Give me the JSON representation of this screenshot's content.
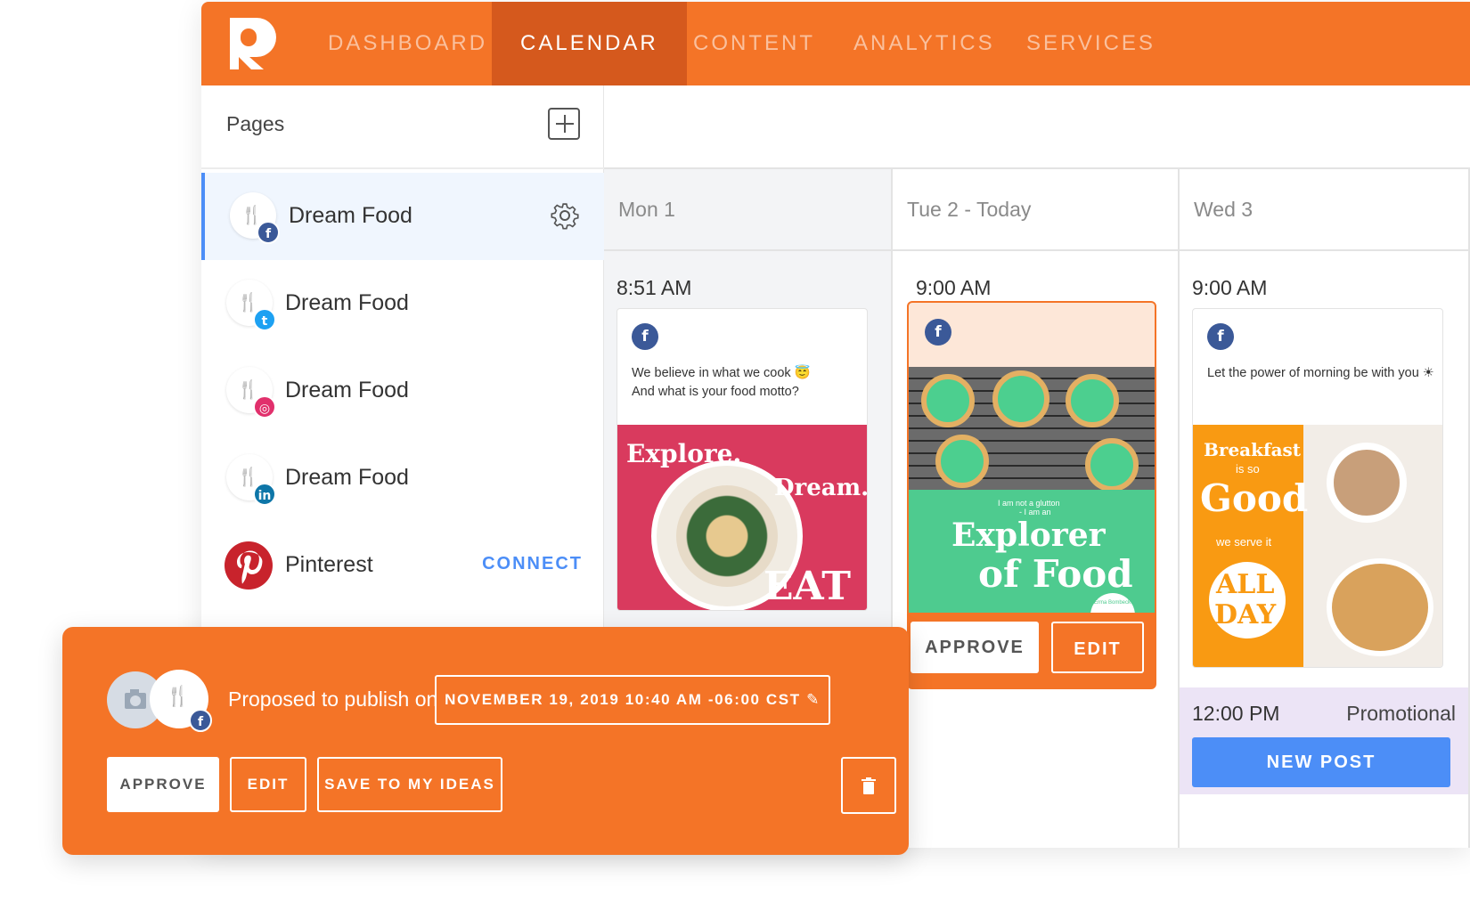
{
  "nav": {
    "items": [
      "DASHBOARD",
      "CALENDAR",
      "CONTENT",
      "ANALYTICS",
      "SERVICES"
    ],
    "active": "CALENDAR"
  },
  "sidebar": {
    "title": "Pages",
    "pages": [
      {
        "name": "Dream Food",
        "network": "facebook"
      },
      {
        "name": "Dream Food",
        "network": "twitter"
      },
      {
        "name": "Dream Food",
        "network": "instagram"
      },
      {
        "name": "Dream Food",
        "network": "linkedin"
      },
      {
        "name": "Pinterest",
        "network": "pinterest",
        "action": "CONNECT"
      }
    ]
  },
  "calendar": {
    "days": [
      {
        "title": "Mon 1",
        "time": "8:51 AM",
        "post_text": [
          "We believe in what we cook 😇",
          "And what is your food motto?"
        ],
        "image_text": [
          "Explore.",
          "Dream.",
          "EAT"
        ]
      },
      {
        "title": "Tue 2 - Today",
        "time": "9:00 AM",
        "image_text": [
          "I am not a glutton",
          "- I am an",
          "Explorer",
          "of Food",
          "Erma Bombeck"
        ],
        "approve": "APPROVE",
        "edit": "EDIT"
      },
      {
        "title": "Wed 3",
        "time": "9:00 AM",
        "post_text": [
          "Let the power of morning be with you ☀"
        ],
        "image_text": [
          "Breakfast",
          "is so",
          "Good",
          "we serve it",
          "ALL",
          "DAY"
        ]
      }
    ],
    "extra_slot": {
      "time": "12:00 PM",
      "label": "Promotional",
      "button": "NEW POST"
    }
  },
  "popup": {
    "label": "Proposed to publish on",
    "date": "NOVEMBER 19, 2019 10:40 AM -06:00 CST",
    "approve": "APPROVE",
    "edit": "EDIT",
    "save": "SAVE TO MY IDEAS"
  },
  "colors": {
    "brand": "#f47427",
    "brand_dark": "#d5591d",
    "accent_blue": "#4c8ef7",
    "facebook": "#3b5998"
  }
}
